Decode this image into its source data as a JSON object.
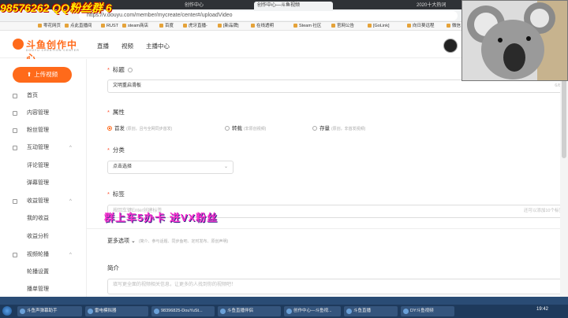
{
  "overlay": {
    "qq_text": "98576262  QQ粉丝群  6",
    "banner": "群上车5办卡    进VX粉丝"
  },
  "browser": {
    "tabs": [
      "创作中心",
      "创作中心—斗鱼视频",
      "2020十大热词"
    ],
    "url": "https://v.douyu.com/member/mycreate/center#/uploadVideo",
    "bookmarks": [
      "零花网页",
      "点此直播间",
      "RUST",
      "steam商店",
      "百度",
      "虎牙直播-",
      "[新品牌]",
      "在线透明",
      "Steam 社区",
      "官网公告",
      "[GoLink]",
      "向日葵远程",
      "微信"
    ]
  },
  "header": {
    "logo_title": "斗鱼创作中心",
    "logo_sub": "DOUYU CREATION CENTER",
    "nav": [
      "直播",
      "视频",
      "主播中心"
    ]
  },
  "sidebar": {
    "upload_label": "上传视频",
    "items": [
      {
        "label": "首页",
        "icon": "home-icon",
        "chevron": ""
      },
      {
        "label": "内容管理",
        "icon": "content-icon",
        "chevron": ""
      },
      {
        "label": "粉丝管理",
        "icon": "fans-icon",
        "chevron": ""
      },
      {
        "label": "互动管理",
        "icon": "chat-icon",
        "chevron": "^"
      },
      {
        "label": "评论管理",
        "icon": "",
        "chevron": ""
      },
      {
        "label": "弹幕管理",
        "icon": "",
        "chevron": ""
      },
      {
        "label": "收益管理",
        "icon": "money-icon",
        "chevron": "^"
      },
      {
        "label": "我的收益",
        "icon": "",
        "chevron": ""
      },
      {
        "label": "收益分析",
        "icon": "",
        "chevron": ""
      },
      {
        "label": "视频轮播",
        "icon": "video-icon",
        "chevron": "^"
      },
      {
        "label": "轮播设置",
        "icon": "",
        "chevron": ""
      },
      {
        "label": "播单管理",
        "icon": "",
        "chevron": ""
      }
    ]
  },
  "form": {
    "title_label": "标题",
    "title_value": "文明重启滑板",
    "title_counter": "6/80",
    "attr_label": "属性",
    "radios": [
      {
        "label": "首发",
        "hint": "(原创，且与全网同步首发)",
        "checked": true
      },
      {
        "label": "转载",
        "hint": "(非原创视频)",
        "checked": false
      },
      {
        "label": "存量",
        "hint": "(原创，非首发视频)",
        "checked": false
      }
    ],
    "category_label": "分类",
    "category_value": "点击选择",
    "tags_label": "标签",
    "tags_placeholder": "按回车键Enter创建标签",
    "tags_counter": "还可以添加10个标签",
    "more_label": "更多选项",
    "more_hint": "(简介、参与话题、同步鱼吧、定时发布、原创声明)",
    "intro_label": "简介",
    "intro_placeholder": "填写更全面的视频相关信息，让更多的人找到你的视频吧！"
  },
  "taskbar": {
    "tasks": [
      "斗鱼声弹幕助手",
      "雷电模拟器",
      "98396825-DouYuSt...",
      "斗鱼直播伴侣",
      "创作中心—斗鱼视...",
      "斗鱼直播",
      "DY斗鱼视频"
    ],
    "clock": "19:42"
  }
}
